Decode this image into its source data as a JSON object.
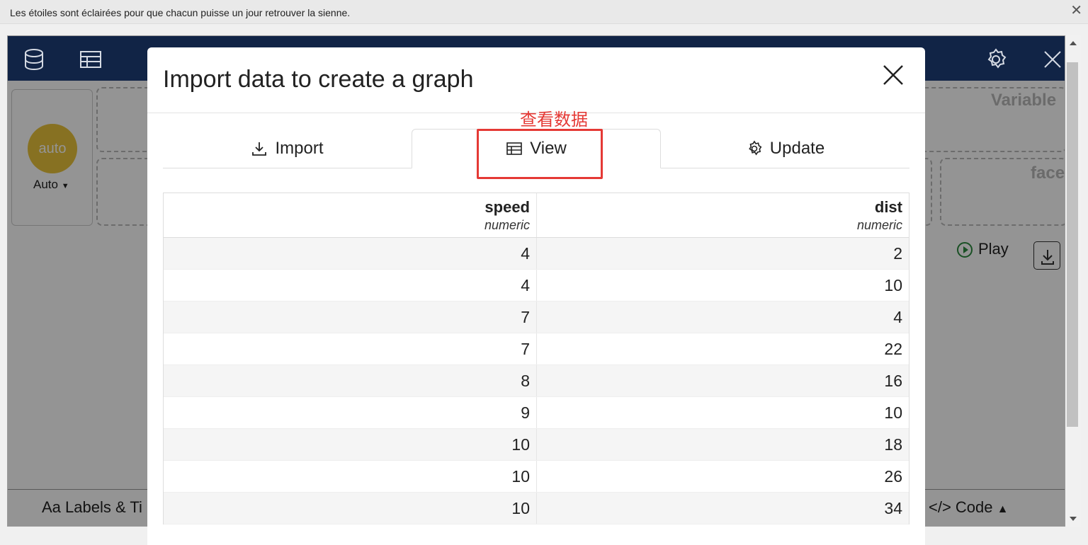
{
  "notification": {
    "message": "Les étoiles sont éclairées pour que chacun puisse un jour retrouver la sienne.",
    "close_glyph": "✕"
  },
  "app": {
    "auto_label": "Auto",
    "auto_badge": "auto",
    "dropzones": {
      "variables": "Variable",
      "group_partial": "p",
      "facet_partial": "face"
    },
    "play_label": "Play",
    "labels_label": "Labels & Ti",
    "labels_prefix": "Aa",
    "code_label": "</> Code",
    "accent_color": "#112446",
    "auto_color": "#e9c33b"
  },
  "modal": {
    "title": "Import data to create a graph",
    "annotation": "查看数据",
    "tabs": [
      {
        "label": "Import",
        "icon": "download-icon"
      },
      {
        "label": "View",
        "icon": "table-icon"
      },
      {
        "label": "Update",
        "icon": "gear-icon"
      }
    ],
    "active_tab": "View",
    "highlight_color": "#e53935"
  },
  "table": {
    "columns": [
      {
        "name": "speed",
        "type": "numeric"
      },
      {
        "name": "dist",
        "type": "numeric"
      }
    ],
    "rows": [
      [
        "4",
        "2"
      ],
      [
        "4",
        "10"
      ],
      [
        "7",
        "4"
      ],
      [
        "7",
        "22"
      ],
      [
        "8",
        "16"
      ],
      [
        "9",
        "10"
      ],
      [
        "10",
        "18"
      ],
      [
        "10",
        "26"
      ],
      [
        "10",
        "34"
      ]
    ]
  }
}
